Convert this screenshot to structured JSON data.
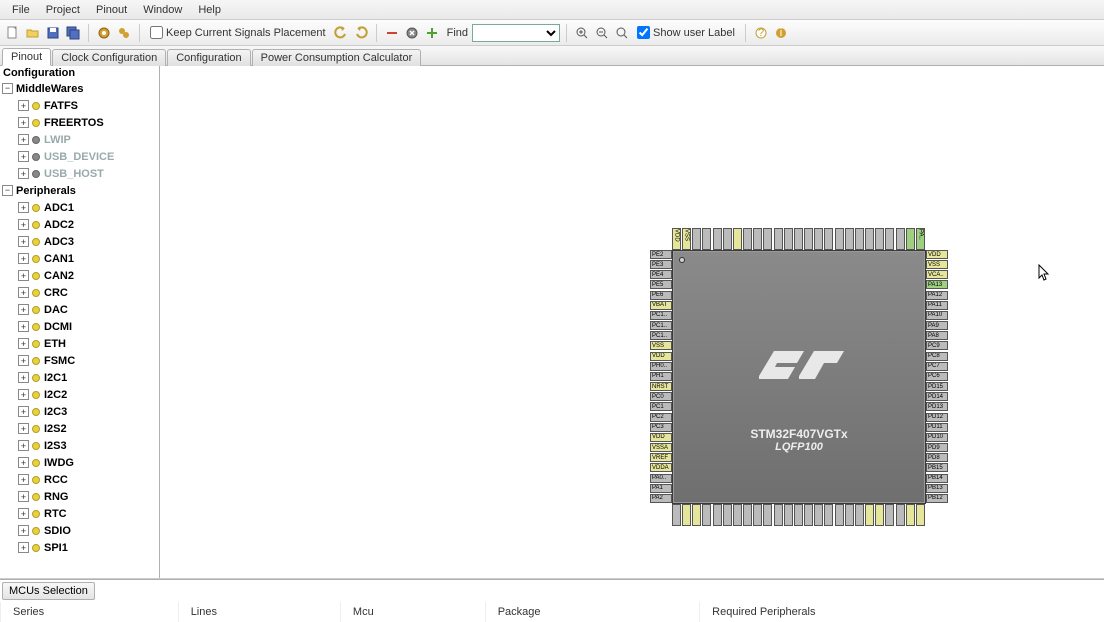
{
  "menu": [
    "File",
    "Project",
    "Pinout",
    "Window",
    "Help"
  ],
  "toolbar": {
    "keep_signals": "Keep Current Signals Placement",
    "find_label": "Find",
    "show_user_label": "Show user Label"
  },
  "tabs": [
    "Pinout",
    "Clock Configuration",
    "Configuration",
    "Power Consumption Calculator"
  ],
  "active_tab": 0,
  "tree": {
    "header": "Configuration",
    "groups": [
      {
        "label": "MiddleWares",
        "children": [
          {
            "label": "FATFS",
            "enabled": true
          },
          {
            "label": "FREERTOS",
            "enabled": true
          },
          {
            "label": "LWIP",
            "enabled": false
          },
          {
            "label": "USB_DEVICE",
            "enabled": false
          },
          {
            "label": "USB_HOST",
            "enabled": false
          }
        ]
      },
      {
        "label": "Peripherals",
        "children": [
          {
            "label": "ADC1",
            "enabled": true
          },
          {
            "label": "ADC2",
            "enabled": true
          },
          {
            "label": "ADC3",
            "enabled": true
          },
          {
            "label": "CAN1",
            "enabled": true
          },
          {
            "label": "CAN2",
            "enabled": true
          },
          {
            "label": "CRC",
            "enabled": true
          },
          {
            "label": "DAC",
            "enabled": true
          },
          {
            "label": "DCMI",
            "enabled": true
          },
          {
            "label": "ETH",
            "enabled": true
          },
          {
            "label": "FSMC",
            "enabled": true
          },
          {
            "label": "I2C1",
            "enabled": true
          },
          {
            "label": "I2C2",
            "enabled": true
          },
          {
            "label": "I2C3",
            "enabled": true
          },
          {
            "label": "I2S2",
            "enabled": true
          },
          {
            "label": "I2S3",
            "enabled": true
          },
          {
            "label": "IWDG",
            "enabled": true
          },
          {
            "label": "RCC",
            "enabled": true
          },
          {
            "label": "RNG",
            "enabled": true
          },
          {
            "label": "RTC",
            "enabled": true
          },
          {
            "label": "SDIO",
            "enabled": true
          },
          {
            "label": "SPI1",
            "enabled": true
          }
        ]
      }
    ]
  },
  "chip": {
    "part": "STM32F407VGTx",
    "package": "LQFP100",
    "pins": {
      "left": [
        {
          "t": "PE2",
          "c": "gray"
        },
        {
          "t": "PE3",
          "c": "gray"
        },
        {
          "t": "PE4",
          "c": "gray"
        },
        {
          "t": "PE5",
          "c": "gray"
        },
        {
          "t": "PE6",
          "c": "gray"
        },
        {
          "t": "VBAT",
          "c": "y"
        },
        {
          "t": "PC1..",
          "c": "gray"
        },
        {
          "t": "PC1..",
          "c": "gray"
        },
        {
          "t": "PC1..",
          "c": "gray"
        },
        {
          "t": "VSS",
          "c": "y"
        },
        {
          "t": "VDD",
          "c": "y"
        },
        {
          "t": "PH0..",
          "c": "gray"
        },
        {
          "t": "PH1",
          "c": "gray"
        },
        {
          "t": "NRST",
          "c": "y"
        },
        {
          "t": "PC0",
          "c": "gray"
        },
        {
          "t": "PC1",
          "c": "gray"
        },
        {
          "t": "PC2",
          "c": "gray"
        },
        {
          "t": "PC3",
          "c": "gray"
        },
        {
          "t": "VDD",
          "c": "y"
        },
        {
          "t": "VSSA",
          "c": "y"
        },
        {
          "t": "VREF",
          "c": "y"
        },
        {
          "t": "VDDA",
          "c": "y"
        },
        {
          "t": "PA0..",
          "c": "gray"
        },
        {
          "t": "PA1",
          "c": "gray"
        },
        {
          "t": "PA2",
          "c": "gray"
        }
      ],
      "right": [
        {
          "t": "VDD",
          "c": "y"
        },
        {
          "t": "VSS",
          "c": "y"
        },
        {
          "t": "VCA..",
          "c": "y"
        },
        {
          "t": "PA13",
          "c": "green"
        },
        {
          "t": "PA12",
          "c": "gray"
        },
        {
          "t": "PA11",
          "c": "gray"
        },
        {
          "t": "PA10",
          "c": "gray"
        },
        {
          "t": "PA9",
          "c": "gray"
        },
        {
          "t": "PA8",
          "c": "gray"
        },
        {
          "t": "PC9",
          "c": "gray"
        },
        {
          "t": "PC8",
          "c": "gray"
        },
        {
          "t": "PC7",
          "c": "gray"
        },
        {
          "t": "PC6",
          "c": "gray"
        },
        {
          "t": "PD15",
          "c": "gray"
        },
        {
          "t": "PD14",
          "c": "gray"
        },
        {
          "t": "PD13",
          "c": "gray"
        },
        {
          "t": "PD12",
          "c": "gray"
        },
        {
          "t": "PD11",
          "c": "gray"
        },
        {
          "t": "PD10",
          "c": "gray"
        },
        {
          "t": "PD9",
          "c": "gray"
        },
        {
          "t": "PD8",
          "c": "gray"
        },
        {
          "t": "PB15",
          "c": "gray"
        },
        {
          "t": "PB14",
          "c": "gray"
        },
        {
          "t": "PB13",
          "c": "gray"
        },
        {
          "t": "PB12",
          "c": "gray"
        }
      ],
      "top": [
        {
          "t": "VDD",
          "c": "y"
        },
        {
          "t": "VSS",
          "c": "y"
        },
        {
          "t": "",
          "c": "gray"
        },
        {
          "t": "",
          "c": "gray"
        },
        {
          "t": "",
          "c": "gray"
        },
        {
          "t": "",
          "c": "gray"
        },
        {
          "t": "",
          "c": "y"
        },
        {
          "t": "",
          "c": "gray"
        },
        {
          "t": "",
          "c": "gray"
        },
        {
          "t": "",
          "c": "gray"
        },
        {
          "t": "",
          "c": "gray"
        },
        {
          "t": "",
          "c": "gray"
        },
        {
          "t": "",
          "c": "gray"
        },
        {
          "t": "",
          "c": "gray"
        },
        {
          "t": "",
          "c": "gray"
        },
        {
          "t": "",
          "c": "gray"
        },
        {
          "t": "",
          "c": "gray"
        },
        {
          "t": "",
          "c": "gray"
        },
        {
          "t": "",
          "c": "gray"
        },
        {
          "t": "",
          "c": "gray"
        },
        {
          "t": "",
          "c": "gray"
        },
        {
          "t": "",
          "c": "gray"
        },
        {
          "t": "",
          "c": "gray"
        },
        {
          "t": "",
          "c": "green"
        },
        {
          "t": "PA..",
          "c": "green"
        }
      ],
      "bottom": [
        {
          "t": "",
          "c": "gray"
        },
        {
          "t": "",
          "c": "y"
        },
        {
          "t": "",
          "c": "y"
        },
        {
          "t": "",
          "c": "gray"
        },
        {
          "t": "",
          "c": "gray"
        },
        {
          "t": "",
          "c": "gray"
        },
        {
          "t": "",
          "c": "gray"
        },
        {
          "t": "",
          "c": "gray"
        },
        {
          "t": "",
          "c": "gray"
        },
        {
          "t": "",
          "c": "gray"
        },
        {
          "t": "",
          "c": "gray"
        },
        {
          "t": "",
          "c": "gray"
        },
        {
          "t": "",
          "c": "gray"
        },
        {
          "t": "",
          "c": "gray"
        },
        {
          "t": "",
          "c": "gray"
        },
        {
          "t": "",
          "c": "gray"
        },
        {
          "t": "",
          "c": "gray"
        },
        {
          "t": "",
          "c": "gray"
        },
        {
          "t": "",
          "c": "gray"
        },
        {
          "t": "",
          "c": "y"
        },
        {
          "t": "",
          "c": "y"
        },
        {
          "t": "",
          "c": "gray"
        },
        {
          "t": "",
          "c": "gray"
        },
        {
          "t": "",
          "c": "y"
        },
        {
          "t": "",
          "c": "y"
        }
      ]
    }
  },
  "bottom": {
    "title": "MCUs Selection",
    "columns": [
      "Series",
      "Lines",
      "Mcu",
      "Package",
      "Required Peripherals"
    ]
  }
}
